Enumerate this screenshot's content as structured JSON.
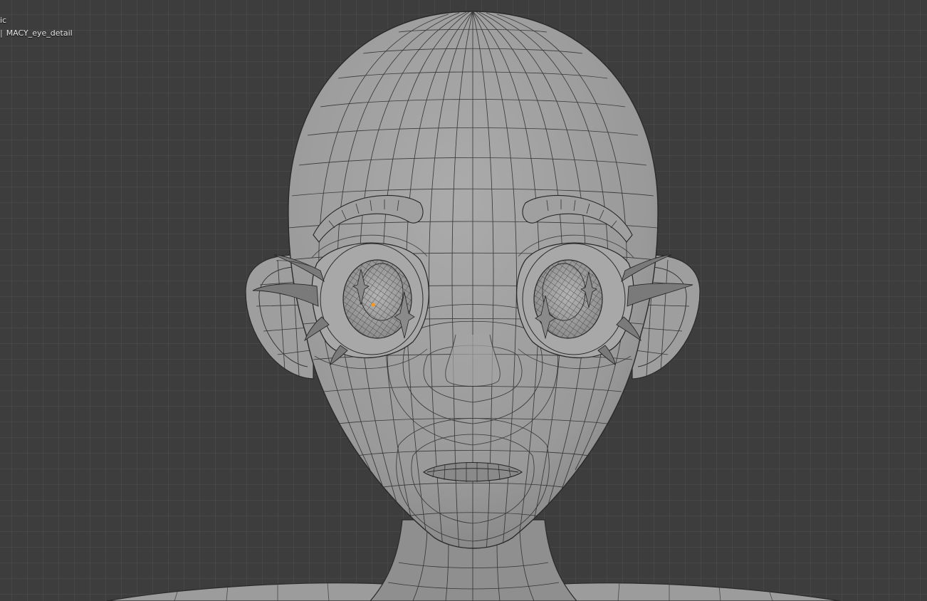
{
  "viewport": {
    "view_name_partial": "nic",
    "collection_object": "MACY_eye_detail",
    "colors": {
      "grid_background": "#3d3d3d",
      "model_fill": "#9a9a9a",
      "wire": "#2a2a2a",
      "origin_dot": "#ff9a1f"
    }
  },
  "objects": [
    {
      "name": "head-mesh"
    },
    {
      "name": "left-ear"
    },
    {
      "name": "right-ear"
    },
    {
      "name": "left-eye"
    },
    {
      "name": "right-eye"
    },
    {
      "name": "left-brow"
    },
    {
      "name": "right-brow"
    },
    {
      "name": "nose"
    },
    {
      "name": "mouth"
    },
    {
      "name": "neck"
    },
    {
      "name": "shoulders"
    }
  ]
}
